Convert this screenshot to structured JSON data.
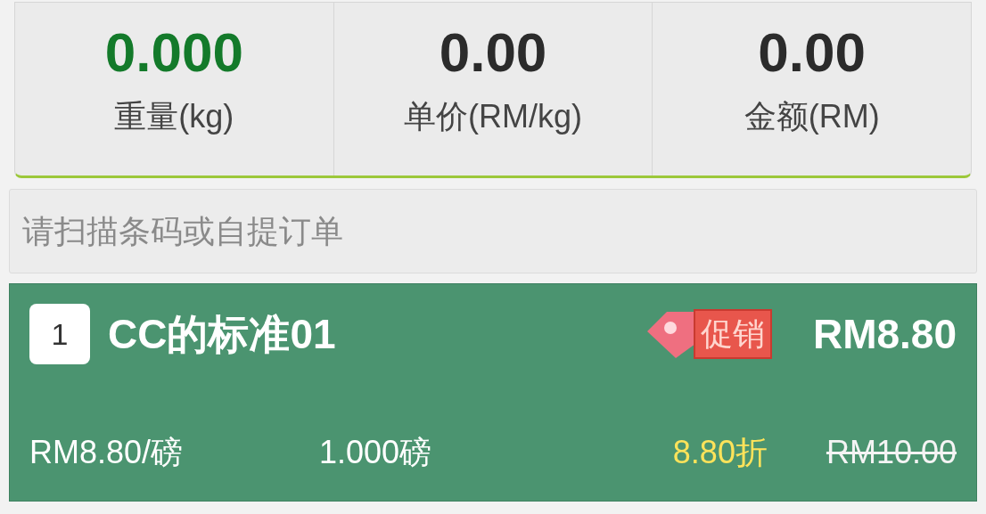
{
  "scale_readouts": [
    {
      "value": "0.000",
      "label": "重量(kg)",
      "kind": "primary"
    },
    {
      "value": "0.00",
      "label": "单价(RM/kg)",
      "kind": "normal"
    },
    {
      "value": "0.00",
      "label": "金额(RM)",
      "kind": "normal"
    }
  ],
  "search": {
    "placeholder": "请扫描条码或自提订单"
  },
  "items": [
    {
      "index": "1",
      "name": "CC的标准01",
      "promo_badge": "促销",
      "price": "RM8.80",
      "unit_price": "RM8.80/磅",
      "quantity": "1.000磅",
      "discount": "8.80折",
      "original_price": "RM10.00"
    }
  ]
}
